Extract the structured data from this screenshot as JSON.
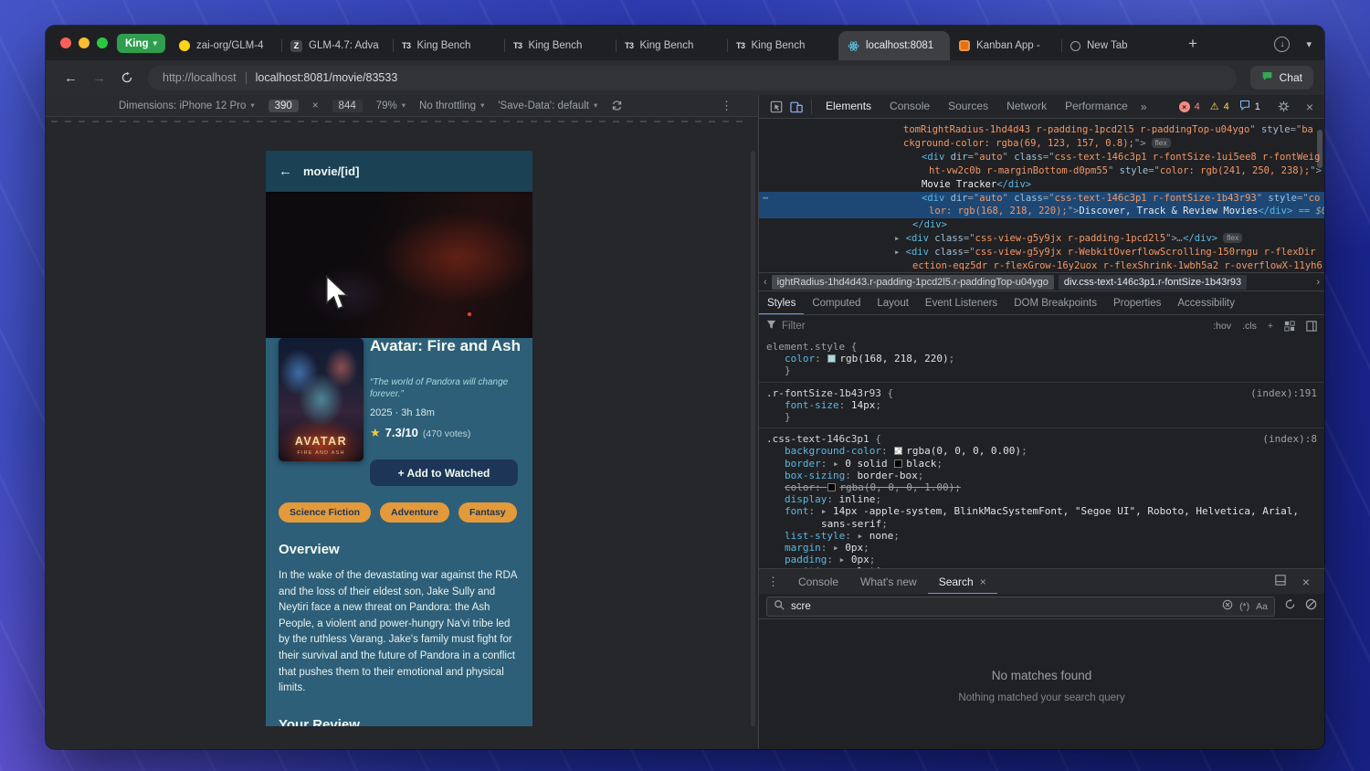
{
  "window": {
    "tab_group_label": "King",
    "tabs": [
      {
        "label": "zai-org/GLM-4",
        "icon": "huggingface-icon"
      },
      {
        "label": "GLM-4.7: Adva",
        "icon": "z-icon",
        "glyph": "Z"
      },
      {
        "label": "King Bench",
        "icon": "t3-icon",
        "glyph": "T3"
      },
      {
        "label": "King Bench",
        "icon": "t3-icon",
        "glyph": "T3"
      },
      {
        "label": "King Bench",
        "icon": "t3-icon",
        "glyph": "T3"
      },
      {
        "label": "King Bench",
        "icon": "t3-icon",
        "glyph": "T3"
      },
      {
        "label": "localhost:8081",
        "icon": "react-icon",
        "active": true
      },
      {
        "label": "Kanban App - ",
        "icon": "kanban-icon"
      },
      {
        "label": "New Tab",
        "icon": "globe-icon"
      }
    ],
    "address": {
      "prefix": "http://localhost",
      "url": "localhost:8081/movie/83533"
    },
    "chat_label": "Chat"
  },
  "device_toolbar": {
    "dimensions": "Dimensions: iPhone 12 Pro",
    "width": "390",
    "times": "×",
    "height": "844",
    "zoom": "79%",
    "throttling": "No throttling",
    "save_data": "'Save-Data': default"
  },
  "app": {
    "header_title": "movie/[id]",
    "back_glyph": "←",
    "movie": {
      "title": "Avatar: Fire and Ash",
      "tagline": "“The world of Pandora will change forever.”",
      "meta": "2025 · 3h 18m",
      "star": "★",
      "rating": "7.3/10",
      "votes": "(470 votes)",
      "add_button": "+ Add to Watched",
      "genres": [
        "Science Fiction",
        "Adventure",
        "Fantasy"
      ],
      "overview_heading": "Overview",
      "overview": "In the wake of the devastating war against the RDA and the loss of their eldest son, Jake Sully and Neytiri face a new threat on Pandora: the Ash People, a violent and power-hungry Na'vi tribe led by the ruthless Varang. Jake's family must fight for their survival and the future of Pandora in a conflict that pushes them to their emotional and physical limits.",
      "review_heading": "Your Review",
      "poster_title": "AVATAR",
      "poster_subtitle": "FIRE AND ASH"
    }
  },
  "devtools": {
    "toolbar": {
      "tabs": [
        "Elements",
        "Console",
        "Sources",
        "Network",
        "Performance"
      ],
      "more_glyph": "»",
      "errors": "4",
      "warnings": "4",
      "issues": "1"
    },
    "dom_tree": {
      "lines": [
        {
          "indent": 158,
          "tokens": [
            [
              "val",
              "tomRightRadius-1hd4d43 r-padding-1pcd2l5 r-paddingTop-u04ygo"
            ],
            [
              "punct",
              "\" "
            ],
            [
              "attr",
              "style"
            ],
            [
              "punct",
              "=\""
            ],
            [
              "val",
              "ba"
            ]
          ]
        },
        {
          "indent": 158,
          "tokens": [
            [
              "val",
              "ckground-color: rgba(69, 123, 157, 0.8);"
            ],
            [
              "punct",
              "\">"
            ],
            [
              "badge",
              "flex"
            ]
          ]
        },
        {
          "indent": 178,
          "tokens": [
            [
              "tag",
              "<div"
            ],
            [
              "attr",
              " dir"
            ],
            [
              "punct",
              "=\""
            ],
            [
              "val",
              "auto"
            ],
            [
              "punct",
              "\""
            ],
            [
              "attr",
              " class"
            ],
            [
              "punct",
              "=\""
            ],
            [
              "val",
              "css-text-146c3p1 r-fontSize-1ui5ee8 r-fontWeig"
            ]
          ]
        },
        {
          "indent": 186,
          "tokens": [
            [
              "val",
              "ht-vw2c0b r-marginBottom-d0pm55"
            ],
            [
              "punct",
              "\""
            ],
            [
              "attr",
              " style"
            ],
            [
              "punct",
              "=\""
            ],
            [
              "val",
              "color: rgb(241, 250, 238);"
            ],
            [
              "punct",
              "\">"
            ]
          ]
        },
        {
          "indent": 178,
          "tokens": [
            [
              "txt",
              "Movie Tracker"
            ],
            [
              "tag",
              "</div>"
            ]
          ]
        },
        {
          "indent": 178,
          "selected": true,
          "gutter": "⋯",
          "tokens": [
            [
              "tag",
              "<div"
            ],
            [
              "attr",
              " dir"
            ],
            [
              "punct",
              "=\""
            ],
            [
              "val",
              "auto"
            ],
            [
              "punct",
              "\""
            ],
            [
              "attr",
              " class"
            ],
            [
              "punct",
              "=\""
            ],
            [
              "val",
              "css-text-146c3p1 r-fontSize-1b43r93"
            ],
            [
              "punct",
              "\""
            ],
            [
              "attr",
              " style"
            ],
            [
              "punct",
              "=\""
            ],
            [
              "val",
              "co"
            ]
          ]
        },
        {
          "indent": 186,
          "selected": true,
          "tokens": [
            [
              "val",
              "lor: rgb(168, 218, 220);"
            ],
            [
              "punct",
              "\">"
            ],
            [
              "txt",
              "Discover, Track & Review Movies"
            ],
            [
              "tag",
              "</div>"
            ],
            [
              "dim",
              " == $0"
            ]
          ]
        },
        {
          "indent": 168,
          "tokens": [
            [
              "tag",
              "</div>"
            ]
          ]
        },
        {
          "indent": 148,
          "tokens": [
            [
              "arrow",
              "▸ "
            ],
            [
              "tag",
              "<div"
            ],
            [
              "attr",
              " class"
            ],
            [
              "punct",
              "=\""
            ],
            [
              "val",
              "css-view-g5y9jx r-padding-1pcd2l5"
            ],
            [
              "punct",
              "\">"
            ],
            [
              "dim",
              "…"
            ],
            [
              "tag",
              "</div>"
            ],
            [
              "badge",
              "flex"
            ]
          ]
        },
        {
          "indent": 148,
          "tokens": [
            [
              "arrow",
              "▸ "
            ],
            [
              "tag",
              "<div"
            ],
            [
              "attr",
              " class"
            ],
            [
              "punct",
              "=\""
            ],
            [
              "val",
              "css-view-g5y9jx r-WebkitOverflowScrolling-150rngu r-flexDir"
            ]
          ]
        },
        {
          "indent": 168,
          "tokens": [
            [
              "val",
              "ection-eqz5dr r-flexGrow-16y2uox r-flexShrink-1wbh5a2 r-overflowX-11yh6"
            ]
          ]
        }
      ]
    },
    "breadcrumbs": {
      "crumb1": "ightRadius-1hd4d43.r-padding-1pcd2l5.r-paddingTop-u04ygo",
      "crumb2": "div.css-text-146c3p1.r-fontSize-1b43r93"
    },
    "styles_pane": {
      "tabs": [
        "Styles",
        "Computed",
        "Layout",
        "Event Listeners",
        "DOM Breakpoints",
        "Properties",
        "Accessibility"
      ],
      "filter_placeholder": "Filter",
      "toggles": {
        "hov": ":hov",
        "cls": ".cls",
        "add": "+"
      },
      "rules": [
        {
          "selector": "element.style",
          "dim": true,
          "props": [
            {
              "name": "color",
              "swatch": "#a8dadc",
              "value": "rgb(168, 218, 220)"
            }
          ]
        },
        {
          "selector": ".r-fontSize-1b43r93",
          "link": "(index):191",
          "props": [
            {
              "name": "font-size",
              "value": "14px"
            }
          ]
        },
        {
          "selector": ".css-text-146c3p1",
          "link": "(index):8",
          "props": [
            {
              "name": "background-color",
              "swatch": "transparent",
              "value": "rgba(0, 0, 0, 0.00)"
            },
            {
              "name": "border",
              "arrow": true,
              "pre": "0 solid ",
              "swatch": "#000000",
              "value": "black"
            },
            {
              "name": "box-sizing",
              "value": "border-box"
            },
            {
              "name": "color",
              "swatch": "#000000",
              "value": "rgba(0, 0, 0, 1.00)",
              "struck": true
            },
            {
              "name": "display",
              "value": "inline"
            },
            {
              "name": "font",
              "arrow": true,
              "value": "14px -apple-system, BlinkMacSystemFont, \"Segoe UI\", Roboto, Helvetica, Arial, sans-serif"
            },
            {
              "name": "list-style",
              "arrow": true,
              "value": "none"
            },
            {
              "name": "margin",
              "arrow": true,
              "value": "0px"
            },
            {
              "name": "padding",
              "arrow": true,
              "value": "0px"
            },
            {
              "name": "position",
              "value": "relative"
            }
          ]
        }
      ]
    },
    "drawer": {
      "tabs": [
        "Console",
        "What's new",
        "Search"
      ],
      "search_query": "scre",
      "regex_label": "(*)",
      "case_label": "Aa",
      "empty_title": "No matches found",
      "empty_subtitle": "Nothing matched your search query"
    }
  }
}
